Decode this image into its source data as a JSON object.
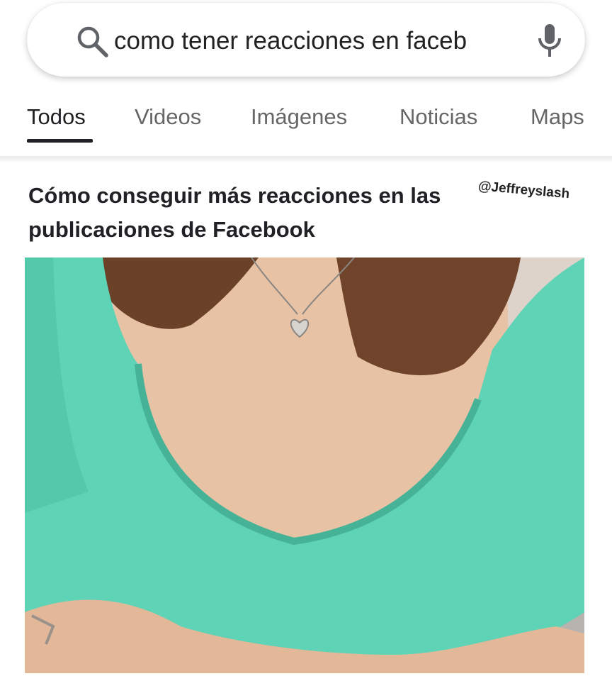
{
  "search": {
    "query": "como tener reacciones en faceb"
  },
  "icons": {
    "search": "search-icon",
    "mic": "mic-icon"
  },
  "tabs": [
    {
      "label": "Todos",
      "active": true
    },
    {
      "label": "Videos",
      "active": false
    },
    {
      "label": "Imágenes",
      "active": false
    },
    {
      "label": "Noticias",
      "active": false
    },
    {
      "label": "Maps",
      "active": false
    }
  ],
  "result": {
    "title": "Cómo conseguir más reacciones en las publicaciones de Facebook",
    "watermark": "@Jeffreyslash"
  },
  "colors": {
    "accent_icon": "#5f6368",
    "text": "#202124",
    "shirt": "#5fd3b6"
  }
}
